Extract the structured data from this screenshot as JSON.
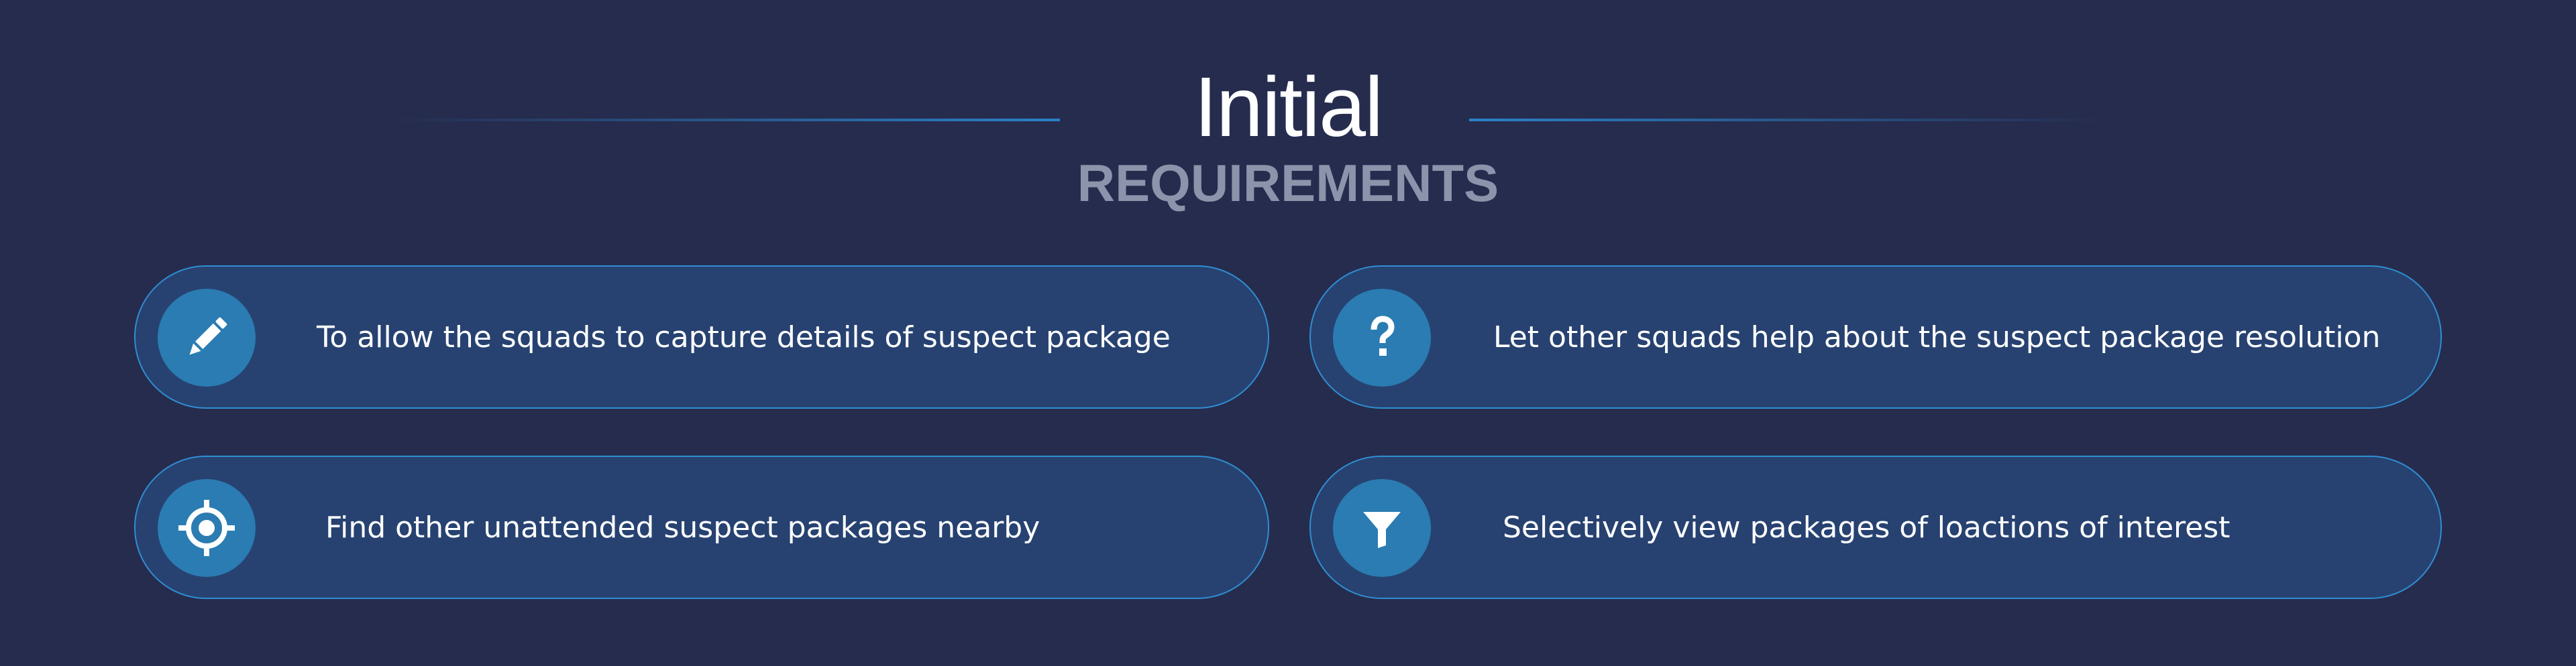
{
  "header": {
    "title": "Initial",
    "subtitle": "REQUIREMENTS"
  },
  "requirements": [
    {
      "icon": "pencil-icon",
      "text": "To allow the squads to capture details of suspect package"
    },
    {
      "icon": "question-icon",
      "text": "Let other squads help about the suspect package resolution"
    },
    {
      "icon": "crosshair-icon",
      "text": "Find other unattended suspect packages nearby"
    },
    {
      "icon": "filter-icon",
      "text": "Selectively view packages of loactions of interest"
    }
  ],
  "colors": {
    "background": "#262c4e",
    "card_fill": "#274271",
    "card_border": "#2f8ed2",
    "icon_circle": "#2a7cb2",
    "subtitle": "#8d93ab",
    "accent_line": "#2a82c8"
  }
}
